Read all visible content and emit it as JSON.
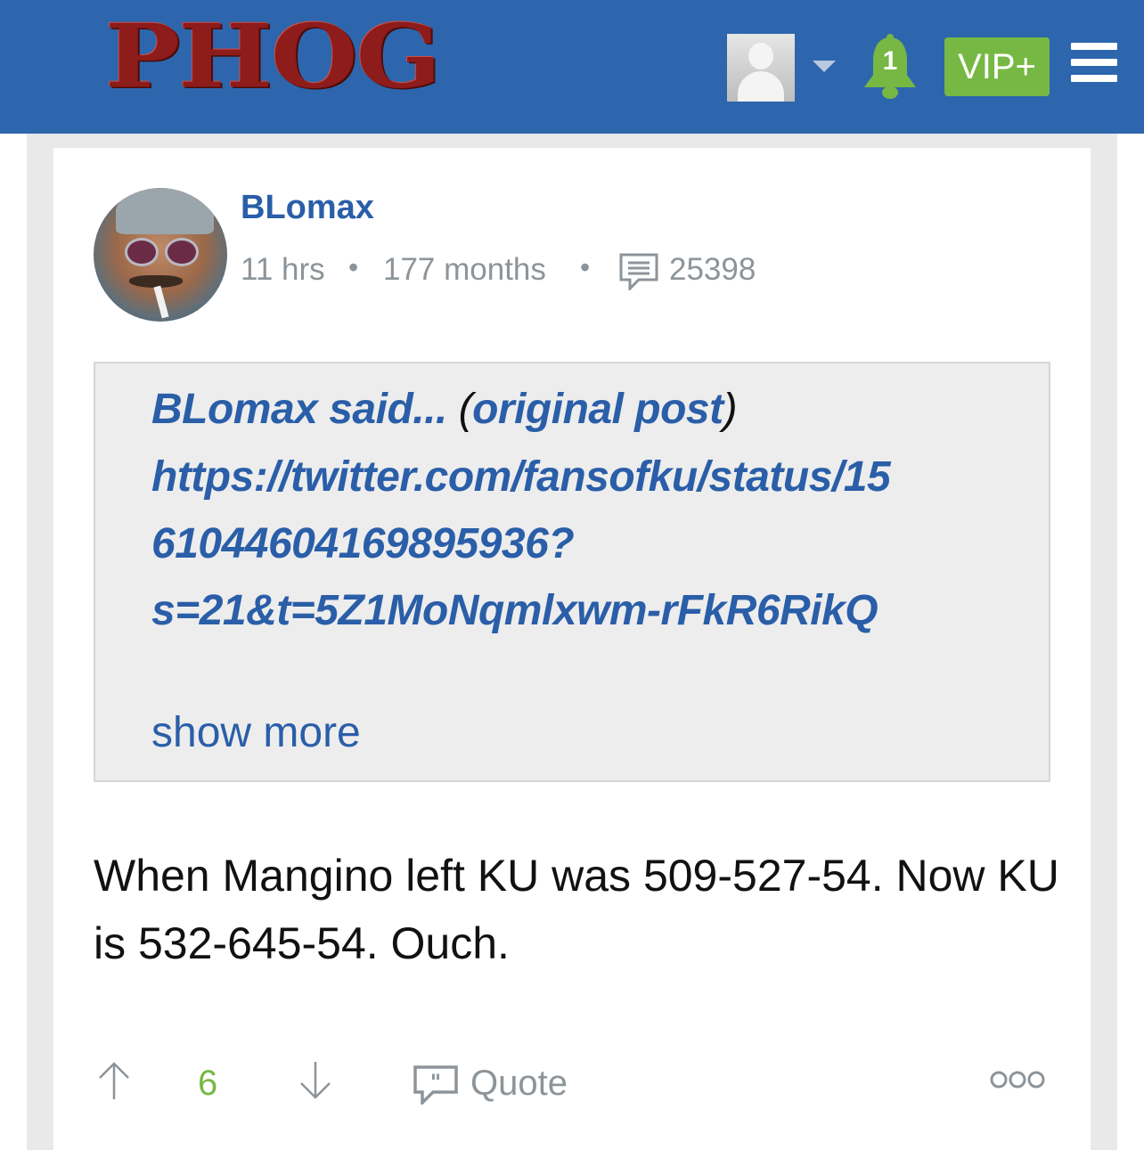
{
  "header": {
    "logo": "PHOG",
    "notification_count": "1",
    "vip_label": "VIP+"
  },
  "post": {
    "author": "BLomax",
    "time_ago": "11 hrs",
    "member_age": "177 months",
    "post_count": "25398",
    "quote": {
      "author_said": "BLomax said...",
      "paren_open": "(",
      "original_post_label": "original post",
      "paren_close": ")",
      "lines": [
        "https://twitter.com/fansofku/status/15",
        "61044604169895936?",
        "s=21&t=5Z1MoNqmlxwm-rFkR6RikQ"
      ],
      "show_more": "show more"
    },
    "body": "When Mangino left KU was 509-527-54. Now KU is 532-645-54. Ouch.",
    "score": "6",
    "quote_label": "Quote"
  },
  "colors": {
    "header_bg": "#2d66ad",
    "logo_red": "#8e1c1a",
    "link_blue": "#2a5ea8",
    "vip_green": "#76b843",
    "meta_gray": "#8d9499"
  },
  "icons": [
    "user-avatar-icon",
    "caret-down-icon",
    "bell-icon",
    "hamburger-menu-icon",
    "comment-count-icon",
    "upvote-arrow-icon",
    "downvote-arrow-icon",
    "quote-icon",
    "more-options-icon"
  ]
}
